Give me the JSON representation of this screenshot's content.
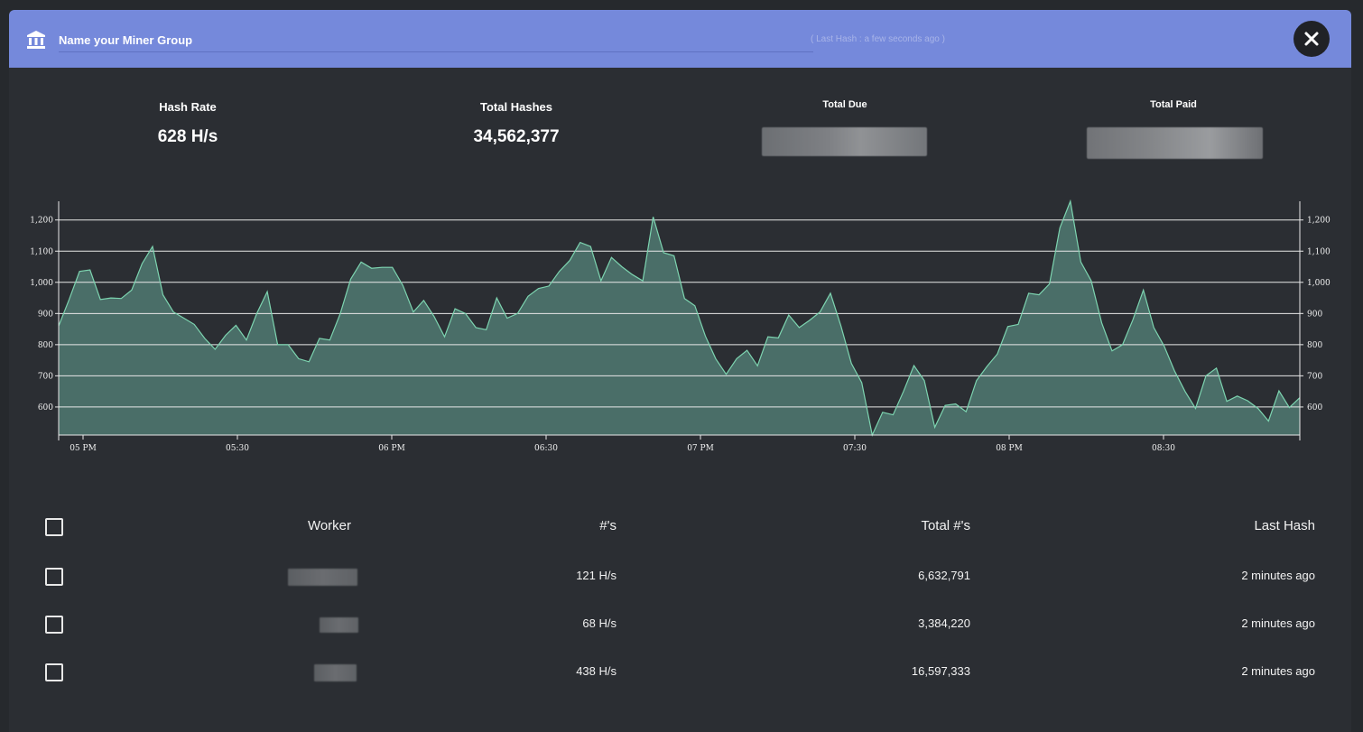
{
  "header": {
    "group_name": "Name your Miner Group",
    "last_hash_info": "( Last Hash : a few seconds ago )",
    "icon": "bank-icon",
    "close_icon": "close-icon",
    "background_color": "#7589db"
  },
  "stats": {
    "hash_rate": {
      "label": "Hash Rate",
      "value": "628 H/s"
    },
    "total_hashes": {
      "label": "Total Hashes",
      "value": "34,562,377"
    },
    "total_due": {
      "label": "Total Due"
    },
    "total_paid": {
      "label": "Total Paid"
    }
  },
  "chart_data": {
    "type": "area",
    "title": "",
    "xlabel": "",
    "ylabel": "",
    "ylim": [
      510,
      1260
    ],
    "yticks": [
      600,
      700,
      800,
      900,
      1000,
      1100,
      1200
    ],
    "ytick_labels": [
      "600",
      "700",
      "800",
      "900",
      "1,000",
      "1,100",
      "1,200"
    ],
    "xticks": [
      "05 PM",
      "05:30",
      "06 PM",
      "06:30",
      "07 PM",
      "07:30",
      "08 PM",
      "08:30"
    ],
    "grid": true,
    "line_color": "#7dd4b0",
    "fill_color": "#4a6e68",
    "series": [
      {
        "values": [
          860,
          945,
          1035,
          1040,
          945,
          950,
          948,
          975,
          1060,
          1115,
          960,
          905,
          885,
          865,
          820,
          785,
          830,
          862,
          815,
          900,
          970,
          800,
          800,
          755,
          745,
          820,
          815,
          900,
          1010,
          1065,
          1045,
          1048,
          1048,
          990,
          905,
          942,
          890,
          825,
          915,
          900,
          855,
          848,
          950,
          885,
          900,
          955,
          980,
          988,
          1035,
          1070,
          1128,
          1115,
          1005,
          1080,
          1050,
          1025,
          1005,
          1210,
          1095,
          1085,
          948,
          925,
          828,
          755,
          705,
          755,
          782,
          732,
          825,
          822,
          895,
          855,
          878,
          905,
          965,
          860,
          740,
          678,
          510,
          583,
          575,
          650,
          733,
          685,
          535,
          605,
          610,
          585,
          685,
          730,
          770,
          858,
          865,
          965,
          960,
          995,
          1175,
          1260,
          1065,
          1005,
          870,
          780,
          800,
          880,
          975,
          855,
          795,
          715,
          650,
          595,
          700,
          725,
          618,
          635,
          620,
          595,
          555,
          652,
          598,
          630
        ]
      }
    ]
  },
  "table": {
    "headers": {
      "worker": "Worker",
      "rate": "#'s",
      "total": "Total #'s",
      "last_hash": "Last Hash"
    },
    "rows": [
      {
        "rate": "121 H/s",
        "total": "6,632,791",
        "last_hash": "2 minutes ago"
      },
      {
        "rate": "68 H/s",
        "total": "3,384,220",
        "last_hash": "2 minutes ago"
      },
      {
        "rate": "438 H/s",
        "total": "16,597,333",
        "last_hash": "2 minutes ago"
      }
    ]
  }
}
